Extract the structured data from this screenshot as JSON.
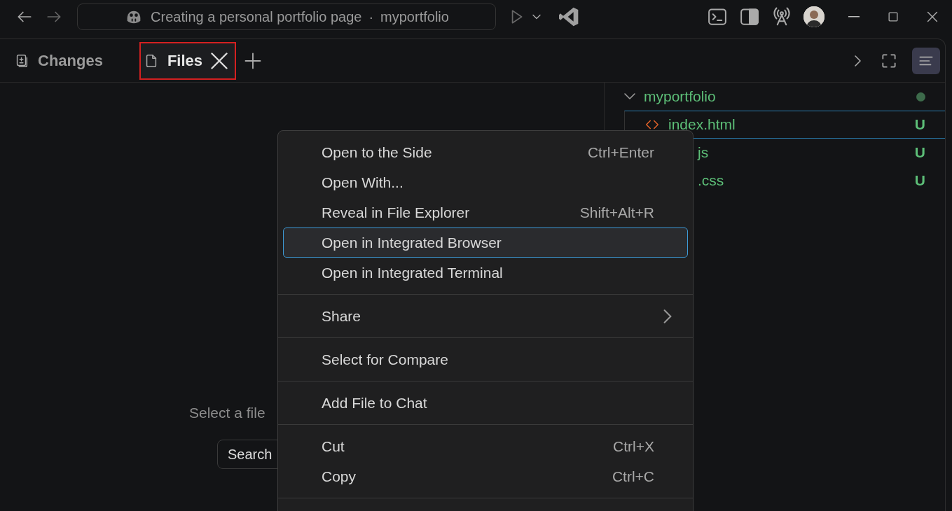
{
  "title_bar": {
    "command_center": {
      "title": "Creating a personal portfolio page",
      "separator": "·",
      "workspace": "myportfolio"
    }
  },
  "tabs": [
    {
      "label": "Changes",
      "kind": "changes",
      "selected": false,
      "closable": false,
      "highlighted": false
    },
    {
      "label": "Files",
      "kind": "files",
      "selected": true,
      "closable": true,
      "highlighted": true
    }
  ],
  "editor": {
    "message": "Select a file",
    "search_button": "Search"
  },
  "file_tree": {
    "folder": {
      "name": "myportfolio",
      "expanded": true
    },
    "files": [
      {
        "name": "index.html",
        "kind": "html",
        "status": "U",
        "selected": true
      },
      {
        "name": "js",
        "kind": "covered",
        "status": "U",
        "selected": false
      },
      {
        "name": ".css",
        "kind": "covered",
        "status": "U",
        "selected": false
      }
    ]
  },
  "context_menu": {
    "groups": [
      {
        "items": [
          {
            "label": "Open to the Side",
            "shortcut": "Ctrl+Enter",
            "submenu": false,
            "selected": false
          },
          {
            "label": "Open With...",
            "submenu": false,
            "selected": false
          },
          {
            "label": "Reveal in File Explorer",
            "shortcut": "Shift+Alt+R",
            "submenu": false,
            "selected": false
          },
          {
            "label": "Open in Integrated Browser",
            "submenu": false,
            "selected": true
          },
          {
            "label": "Open in Integrated Terminal",
            "submenu": false,
            "selected": false
          }
        ]
      },
      {
        "items": [
          {
            "label": "Share",
            "submenu": true,
            "selected": false
          }
        ]
      },
      {
        "items": [
          {
            "label": "Select for Compare",
            "submenu": false,
            "selected": false
          }
        ]
      },
      {
        "items": [
          {
            "label": "Add File to Chat",
            "submenu": false,
            "selected": false
          }
        ]
      },
      {
        "items": [
          {
            "label": "Cut",
            "shortcut": "Ctrl+X",
            "submenu": false,
            "selected": false
          },
          {
            "label": "Copy",
            "shortcut": "Ctrl+C",
            "submenu": false,
            "selected": false
          }
        ]
      }
    ]
  }
}
